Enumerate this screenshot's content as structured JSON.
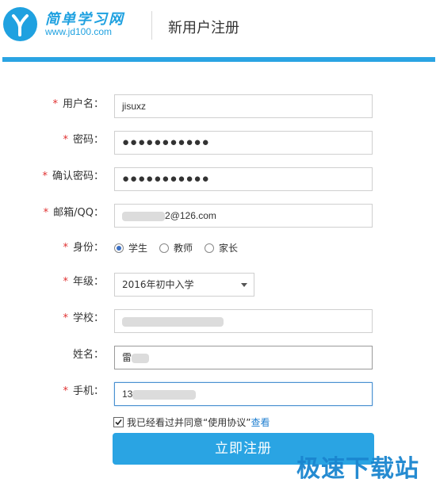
{
  "header": {
    "logo_name": "简单学习网",
    "logo_url": "www.jd100.com",
    "page_title": "新用户注册"
  },
  "form": {
    "required_mark": "*",
    "username": {
      "label": "用户名：",
      "value": "jisuxz"
    },
    "password": {
      "label": "密码：",
      "value": "●●●●●●●●●●●"
    },
    "confirm_password": {
      "label": "确认密码：",
      "value": "●●●●●●●●●●●"
    },
    "email": {
      "label": "邮箱/QQ：",
      "value_suffix": "2@126.com"
    },
    "identity": {
      "label": "身份：",
      "options": [
        {
          "label": "学生",
          "selected": true
        },
        {
          "label": "教师",
          "selected": false
        },
        {
          "label": "家长",
          "selected": false
        }
      ]
    },
    "grade": {
      "label": "年级：",
      "value": "2016年初中入学"
    },
    "school": {
      "label": "学校："
    },
    "name": {
      "label": "姓名：",
      "value": "雷"
    },
    "phone": {
      "label": "手机：",
      "value": "13"
    }
  },
  "agreement": {
    "checked": true,
    "text": "我已经看过并同意“使用协议”",
    "link": "查看"
  },
  "submit_label": "立即注册",
  "watermark": "极速下载站",
  "colors": {
    "brand_blue": "#2aa4e3",
    "required_red": "#e03030",
    "link_blue": "#1f7fd0"
  }
}
